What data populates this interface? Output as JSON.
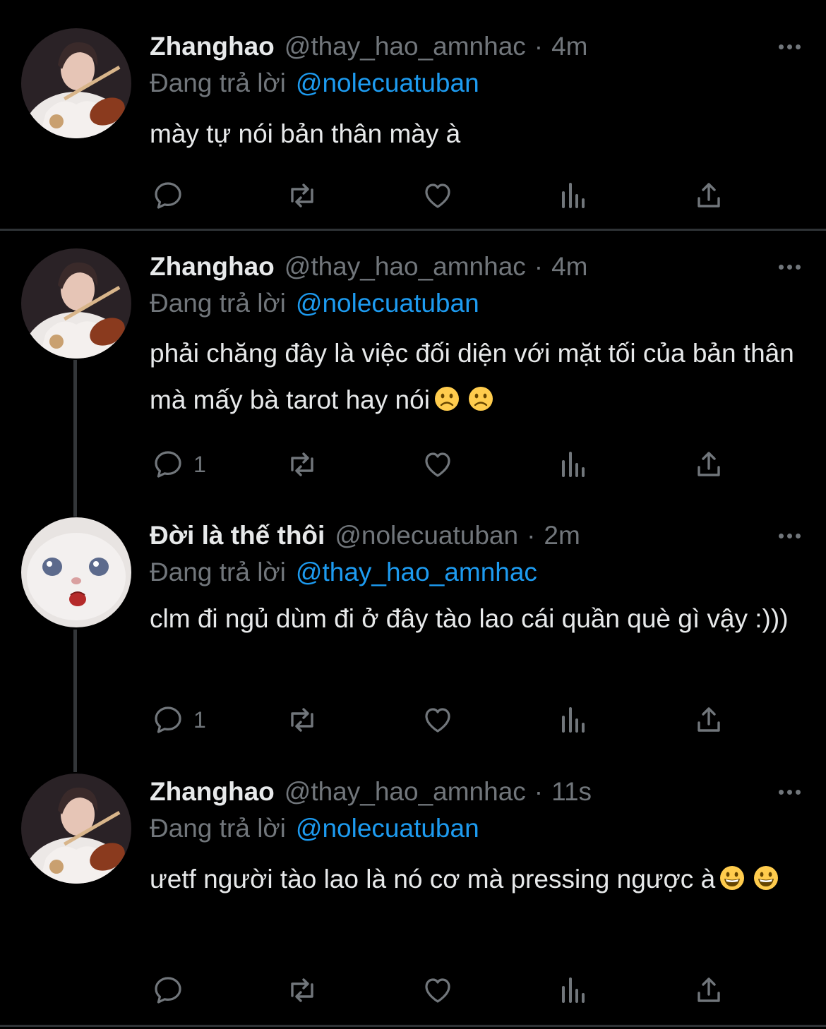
{
  "theme": {
    "background": "#000000",
    "text": "#e7e9ea",
    "muted": "#71767b",
    "link": "#1d9bf0",
    "divider": "#2f3336"
  },
  "tweets": [
    {
      "name": "Zhanghao",
      "handle": "@thay_hao_amnhac",
      "separator": "·",
      "time": "4m",
      "replying_label": "Đang trả lời",
      "replying_to": "@nolecuatuban",
      "text": "mày tự nói bản thân mày à",
      "emojis": [],
      "reply_count": "",
      "avatar": "violinist-avatar"
    },
    {
      "name": "Zhanghao",
      "handle": "@thay_hao_amnhac",
      "separator": "·",
      "time": "4m",
      "replying_label": "Đang trả lời",
      "replying_to": "@nolecuatuban",
      "text": "phải chăng đây là việc đối diện với mặt tối của bản thân mà mấy bà tarot hay nói",
      "emojis": [
        "slightly-frowning-face",
        "slightly-frowning-face"
      ],
      "reply_count": "1",
      "avatar": "violinist-avatar"
    },
    {
      "name": "Đời là thế thôi",
      "handle": "@nolecuatuban",
      "separator": "·",
      "time": "2m",
      "replying_label": "Đang trả lời",
      "replying_to": "@thay_hao_amnhac",
      "text": "clm đi ngủ dùm đi ở đây tào lao cái quần què gì vậy :)))",
      "emojis": [],
      "reply_count": "1",
      "avatar": "cat-avatar"
    },
    {
      "name": "Zhanghao",
      "handle": "@thay_hao_amnhac",
      "separator": "·",
      "time": "11s",
      "replying_label": "Đang trả lời",
      "replying_to": "@nolecuatuban",
      "text": "ưetf người tào lao là nó cơ mà pressing ngược à",
      "emojis": [
        "grinning-face",
        "grinning-face"
      ],
      "reply_count": "",
      "avatar": "violinist-avatar"
    }
  ],
  "icons": {
    "reply": "reply-icon",
    "retweet": "retweet-icon",
    "like": "like-icon",
    "views": "views-icon",
    "share": "share-icon",
    "more": "more-icon"
  }
}
